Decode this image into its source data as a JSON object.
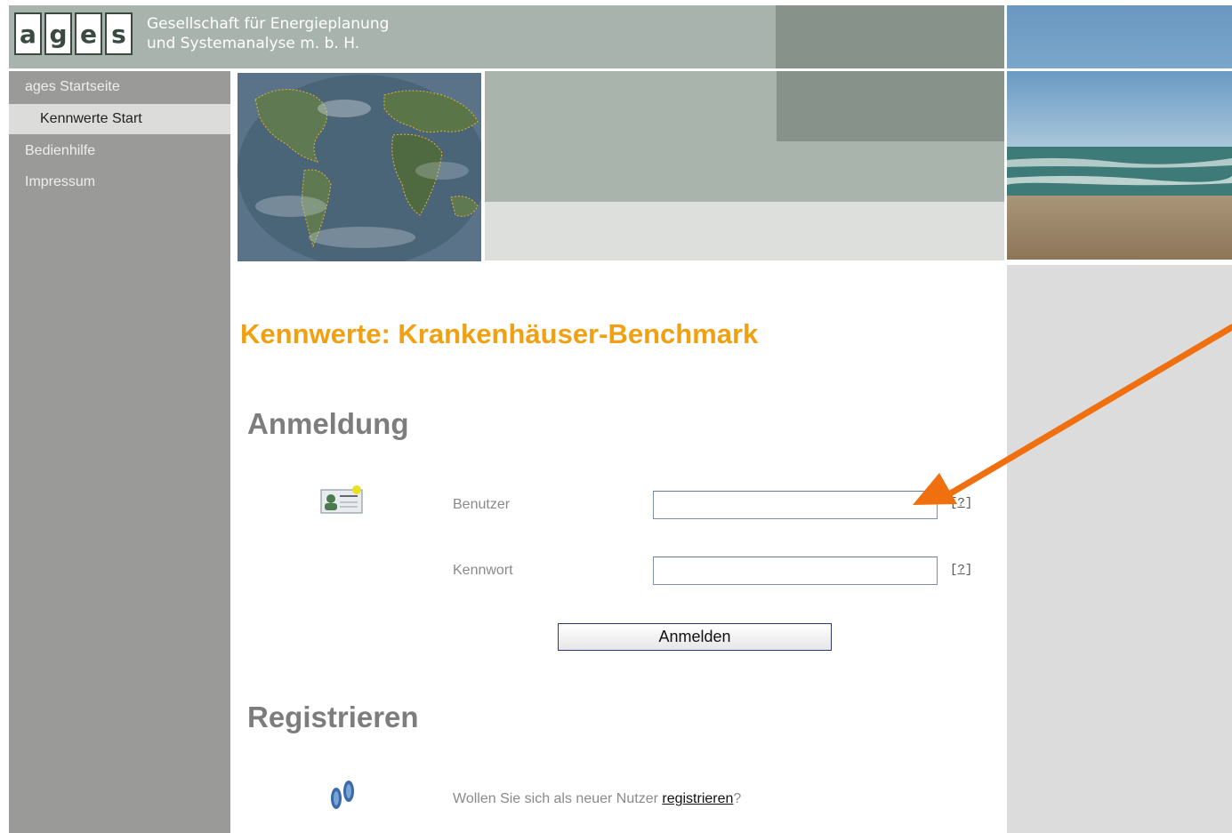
{
  "header": {
    "logo_letters": [
      "a",
      "g",
      "e",
      "s"
    ],
    "company_line1": "Gesellschaft für Energieplanung",
    "company_line2": "und Systemanalyse m. b. H."
  },
  "sidebar": {
    "items": [
      {
        "label": "ages Startseite",
        "active": false
      },
      {
        "label": "Kennwerte Start",
        "active": true
      },
      {
        "label": "Bedienhilfe",
        "active": false
      },
      {
        "label": "Impressum",
        "active": false
      }
    ]
  },
  "main": {
    "title": "Kennwerte: Krankenhäuser-Benchmark",
    "login": {
      "heading": "Anmeldung",
      "user_label": "Benutzer",
      "user_value": "",
      "password_label": "Kennwort",
      "password_value": "",
      "help_label": "?",
      "submit_label": "Anmelden"
    },
    "register": {
      "heading": "Registrieren",
      "text_before": "Wollen Sie sich als neuer Nutzer ",
      "link_label": "registrieren",
      "text_after": "?"
    }
  },
  "colors": {
    "title": "#f0a010",
    "annotation_arrow": "#f07010",
    "header": "#a7b3ac",
    "sidebar": "#9a9a98"
  },
  "icons": {
    "user_card": "id-card-icon",
    "register": "footprints-icon",
    "pointer": "annotation-arrow"
  }
}
